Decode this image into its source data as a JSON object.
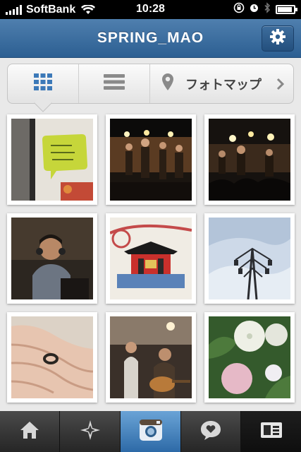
{
  "status_bar": {
    "carrier": "SoftBank",
    "time": "10:28",
    "battery_level": 0.9,
    "icons": [
      "signal-icon",
      "wifi-icon",
      "orientation-lock-icon",
      "alarm-icon",
      "bluetooth-icon",
      "battery-icon"
    ]
  },
  "nav": {
    "title": "SPRING_MAO",
    "settings_icon": "gear-icon"
  },
  "segmented": {
    "grid_icon": "grid-view-icon",
    "list_icon": "list-view-icon",
    "map_icon": "map-pin-icon",
    "map_label": "フォトマップ",
    "selected": "grid"
  },
  "photos": [
    {
      "subject": "green speech bubble note"
    },
    {
      "subject": "band on stage"
    },
    {
      "subject": "live concert crowd"
    },
    {
      "subject": "DJ with headphones"
    },
    {
      "subject": "toy block shrine gate"
    },
    {
      "subject": "power tower against sky"
    },
    {
      "subject": "hand with ring"
    },
    {
      "subject": "acoustic duo performing"
    },
    {
      "subject": "hydrangea flowers"
    }
  ],
  "tab_bar": {
    "items": [
      {
        "icon": "home-icon"
      },
      {
        "icon": "explore-star-icon"
      },
      {
        "icon": "camera-icon"
      },
      {
        "icon": "news-heart-bubble-icon"
      },
      {
        "icon": "profile-card-icon"
      }
    ],
    "selected": "profile",
    "accent": "#3f7dbd"
  },
  "colors": {
    "nav_blue": "#3a6b9c",
    "background": "#e9e9e9"
  }
}
